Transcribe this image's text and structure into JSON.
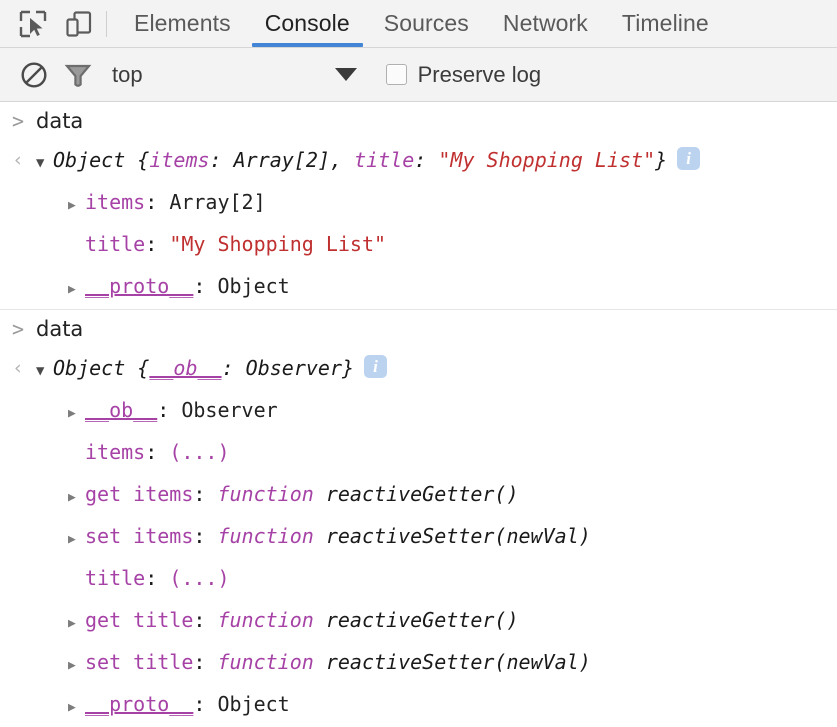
{
  "toolbar": {
    "inspect_icon": "inspect-cursor-icon",
    "device_icon": "device-toolbar-icon",
    "tabs": [
      {
        "label": "Elements",
        "active": false
      },
      {
        "label": "Console",
        "active": true
      },
      {
        "label": "Sources",
        "active": false
      },
      {
        "label": "Network",
        "active": false
      },
      {
        "label": "Timeline",
        "active": false
      }
    ],
    "active_tab": "Console",
    "accent_color": "#4285d6"
  },
  "filterbar": {
    "clear_icon": "clear-console-icon",
    "filter_icon": "filter-funnel-icon",
    "context": "top",
    "dropdown_icon": "chevron-down-icon",
    "preserve_log_label": "Preserve log",
    "preserve_log_checked": false
  },
  "console": {
    "prompt_marker": ">",
    "output_marker": "‹",
    "info_icon_glyph": "i",
    "entries": [
      {
        "command": "data",
        "preview": {
          "prefix": "Object {",
          "parts": [
            {
              "text": "items",
              "style": "key-it"
            },
            {
              "text": ": ",
              "style": "plain-it"
            },
            {
              "text": "Array[2]",
              "style": "plain-it"
            },
            {
              "text": ", ",
              "style": "plain-it"
            },
            {
              "text": "title",
              "style": "key-it"
            },
            {
              "text": ": ",
              "style": "plain-it"
            },
            {
              "text": "\"My Shopping List\"",
              "style": "str-it"
            },
            {
              "text": "}",
              "style": "plain-it"
            }
          ]
        },
        "rows": [
          {
            "disc": "▶",
            "key": "items",
            "sep": ": ",
            "value": "Array[2]",
            "key_style": "key",
            "value_style": "val"
          },
          {
            "disc": "",
            "key": "title",
            "sep": ": ",
            "value": "\"My Shopping List\"",
            "key_style": "key",
            "value_style": "str"
          },
          {
            "disc": "▶",
            "key": "__proto__",
            "sep": ": ",
            "value": "Object",
            "key_style": "key-ul",
            "value_style": "val"
          }
        ]
      },
      {
        "command": "data",
        "preview": {
          "prefix": "Object {",
          "parts": [
            {
              "text": "__ob__",
              "style": "key-ul-it"
            },
            {
              "text": ": ",
              "style": "plain-it"
            },
            {
              "text": "Observer",
              "style": "plain-it"
            },
            {
              "text": "}",
              "style": "plain-it"
            }
          ]
        },
        "rows": [
          {
            "disc": "▶",
            "key": "__ob__",
            "sep": ": ",
            "value": "Observer",
            "key_style": "key-ul",
            "value_style": "val"
          },
          {
            "disc": "",
            "key": "items",
            "sep": ": ",
            "value": "(...)",
            "key_style": "key",
            "value_style": "key"
          },
          {
            "disc": "▶",
            "key": "get items",
            "sep": ": ",
            "value": "function reactiveGetter()",
            "key_style": "key",
            "value_style": "fn"
          },
          {
            "disc": "▶",
            "key": "set items",
            "sep": ": ",
            "value": "function reactiveSetter(newVal)",
            "key_style": "key",
            "value_style": "fn"
          },
          {
            "disc": "",
            "key": "title",
            "sep": ": ",
            "value": "(...)",
            "key_style": "key",
            "value_style": "key"
          },
          {
            "disc": "▶",
            "key": "get title",
            "sep": ": ",
            "value": "function reactiveGetter()",
            "key_style": "key",
            "value_style": "fn"
          },
          {
            "disc": "▶",
            "key": "set title",
            "sep": ": ",
            "value": "function reactiveSetter(newVal)",
            "key_style": "key",
            "value_style": "fn"
          },
          {
            "disc": "▶",
            "key": "__proto__",
            "sep": ": ",
            "value": "Object",
            "key_style": "key-ul",
            "value_style": "val"
          }
        ]
      }
    ]
  }
}
